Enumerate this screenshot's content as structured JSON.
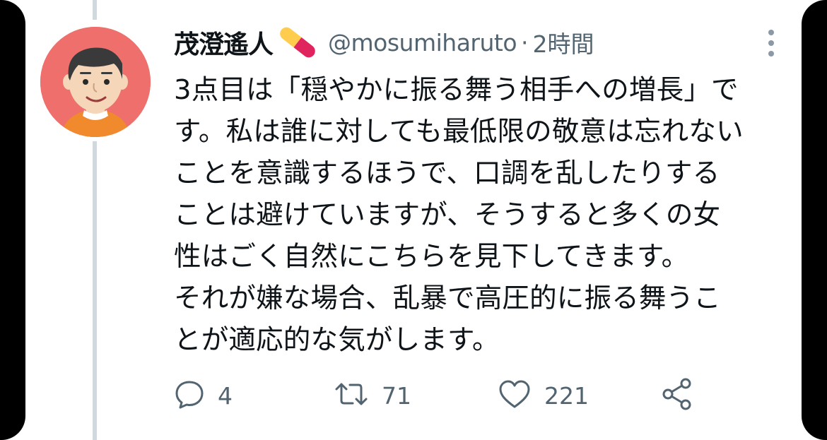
{
  "author": {
    "display_name": "茂澄遙人",
    "badge_icon": "pill-icon",
    "handle": "@mosumiharuto",
    "separator": "·",
    "time": "2時間"
  },
  "tweet": {
    "lines": [
      "3点目は「穏やかに振る舞う相手への増長」で",
      "す。私は誰に対しても最低限の敬意は忘れない",
      "ことを意識するほうで、口調を乱したりする",
      "ことは避けていますが、そうすると多くの女",
      "性はごく自然にこちらを見下してきます。",
      "それが嫌な場合、乱暴で高圧的に振る舞うこ",
      "とが適応的な気がします。"
    ]
  },
  "actions": {
    "reply_count": "4",
    "retweet_count": "71",
    "like_count": "221"
  },
  "colors": {
    "text": "#0f1419",
    "secondary": "#536471",
    "avatar_bg": "#ee6f6c",
    "thread_line": "#cfd9de",
    "pill_red": "#e0245e",
    "pill_yellow": "#ffcc4d"
  }
}
